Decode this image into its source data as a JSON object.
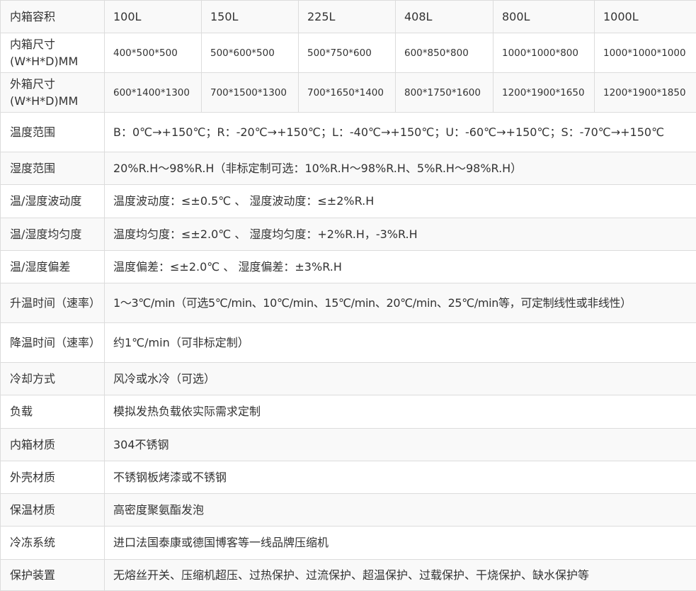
{
  "table": {
    "capacity": {
      "label": "内箱容积",
      "values": [
        "100L",
        "150L",
        "225L",
        "408L",
        "800L",
        "1000L"
      ]
    },
    "inner_size": {
      "label": "内箱尺寸(W*H*D)MM",
      "values": [
        "400*500*500",
        "500*600*500",
        "500*750*600",
        "600*850*800",
        "1000*1000*800",
        "1000*1000*1000"
      ]
    },
    "outer_size": {
      "label": "外箱尺寸(W*H*D)MM",
      "values": [
        "600*1400*1300",
        "700*1500*1300",
        "700*1650*1400",
        "800*1750*1600",
        "1200*1900*1650",
        "1200*1900*1850"
      ]
    },
    "rows": [
      {
        "label": "温度范围",
        "value": "B：0℃→+150℃；R：-20℃→+150℃；L：-40℃→+150℃；U：-60℃→+150℃；S：-70℃→+150℃"
      },
      {
        "label": "湿度范围",
        "value": "20%R.H～98%R.H（非标定制可选：10%R.H～98%R.H、5%R.H～98%R.H）"
      },
      {
        "label": "温/湿度波动度",
        "value": "温度波动度：≤±0.5℃ 、 湿度波动度：≤±2%R.H"
      },
      {
        "label": "温/湿度均匀度",
        "value": "温度均匀度：≤±2.0℃ 、 湿度均匀度：+2%R.H，-3%R.H"
      },
      {
        "label": "温/湿度偏差",
        "value": "温度偏差：≤±2.0℃ 、 湿度偏差：±3%R.H"
      },
      {
        "label": "升温时间（速率）",
        "value": "1～3℃/min（可选5℃/min、10℃/min、15℃/min、20℃/min、25℃/min等，可定制线性或非线性）"
      },
      {
        "label": "降温时间（速率）",
        "value": "约1℃/min（可非标定制）"
      },
      {
        "label": "冷却方式",
        "value": "风冷或水冷（可选）"
      },
      {
        "label": "负载",
        "value": "模拟发热负载依实际需求定制"
      },
      {
        "label": "内箱材质",
        "value": "304不锈钢"
      },
      {
        "label": "外壳材质",
        "value": "不锈钢板烤漆或不锈钢"
      },
      {
        "label": "保温材质",
        "value": "高密度聚氨酯发泡"
      },
      {
        "label": "冷冻系统",
        "value": "进口法国泰康或德国博客等一线品牌压缩机"
      },
      {
        "label": "保护装置",
        "value": "无熔丝开关、压缩机超压、过热保护、过流保护、超温保护、过载保护、干烧保护、缺水保护等"
      }
    ]
  }
}
